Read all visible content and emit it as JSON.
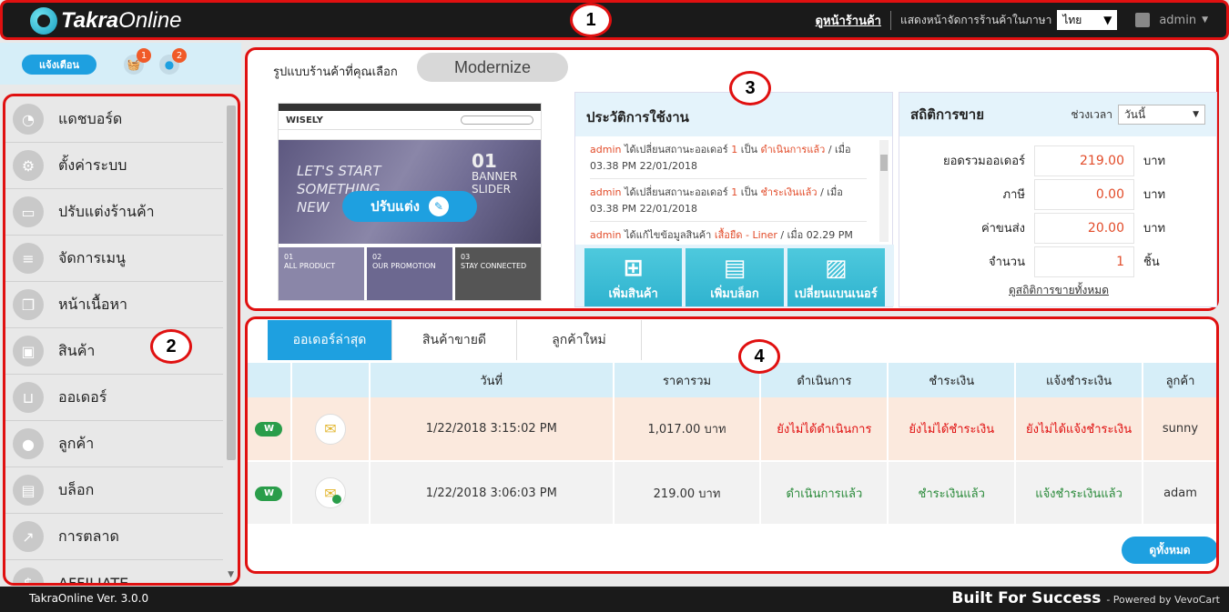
{
  "header": {
    "logo_main": "Takra",
    "logo_sub": "Online",
    "storefront_link": "ดูหน้าร้านค้า",
    "language_label": "แสดงหน้าจัดการร้านค้าในภาษา",
    "language_value": "ไทย",
    "user_name": "admin"
  },
  "sidebar_top": {
    "notify_button": "แจ้งเตือน",
    "cart_badge": "1",
    "user_badge": "2"
  },
  "sidebar": {
    "items": [
      {
        "label": "แดชบอร์ด",
        "icon": "dashboard-icon"
      },
      {
        "label": "ตั้งค่าระบบ",
        "icon": "gear-icon"
      },
      {
        "label": "ปรับแต่งร้านค้า",
        "icon": "monitor-icon"
      },
      {
        "label": "จัดการเมนู",
        "icon": "menu-icon"
      },
      {
        "label": "หน้าเนื้อหา",
        "icon": "pages-icon"
      },
      {
        "label": "สินค้า",
        "icon": "box-icon"
      },
      {
        "label": "ออเดอร์",
        "icon": "basket-icon"
      },
      {
        "label": "ลูกค้า",
        "icon": "person-icon"
      },
      {
        "label": "บล็อก",
        "icon": "blog-icon"
      },
      {
        "label": "การตลาด",
        "icon": "chart-icon"
      },
      {
        "label": "AFFILIATE",
        "icon": "dollar-icon"
      }
    ]
  },
  "annotations": [
    "1",
    "2",
    "3",
    "4"
  ],
  "theme": {
    "label": "รูปแบบร้านค้าที่คุณเลือก",
    "name": "Modernize",
    "customize_button": "ปรับแต่ง",
    "preview_brand": "WISELY",
    "preview_banner_left": "LET'S START SOMETHING NEW",
    "preview_banner_num": "01",
    "preview_banner_right": "BANNER SLIDER",
    "preview_tiles": [
      {
        "num": "01",
        "text": "ALL PRODUCT"
      },
      {
        "num": "02",
        "text": "OUR PROMOTION"
      },
      {
        "num": "03",
        "text": "STAY CONNECTED"
      }
    ]
  },
  "history": {
    "title": "ประวัติการใช้งาน",
    "entries": [
      {
        "user": "admin",
        "a": " ได้เปลี่ยนสถานะออเดอร์ ",
        "num": "1",
        "b": " เป็น ",
        "status": "ดำเนินการแล้ว",
        "c": " / เมื่อ 03.38 PM 22/01/2018"
      },
      {
        "user": "admin",
        "a": " ได้เปลี่ยนสถานะออเดอร์ ",
        "num": "1",
        "b": " เป็น ",
        "status": "ชำระเงินแล้ว",
        "c": " / เมื่อ 03.38 PM 22/01/2018"
      },
      {
        "user": "admin",
        "a": " ได้แก้ไขข้อมูลสินค้า ",
        "num": "",
        "b": "",
        "status": "เสื้อยืด - Liner",
        "c": " / เมื่อ 02.29 PM"
      }
    ],
    "quick_actions": [
      {
        "label": "เพิ่มสินค้า",
        "icon": "add-product-icon"
      },
      {
        "label": "เพิ่มบล็อก",
        "icon": "add-blog-icon"
      },
      {
        "label": "เปลี่ยนแบนเนอร์",
        "icon": "change-banner-icon"
      }
    ]
  },
  "stats": {
    "title": "สถิติการขาย",
    "period_label": "ช่วงเวลา",
    "period_value": "วันนี้",
    "rows": [
      {
        "label": "ยอดรวมออเดอร์",
        "value": "219.00",
        "unit": "บาท"
      },
      {
        "label": "ภาษี",
        "value": "0.00",
        "unit": "บาท"
      },
      {
        "label": "ค่าขนส่ง",
        "value": "20.00",
        "unit": "บาท"
      },
      {
        "label": "จำนวน",
        "value": "1",
        "unit": "ชิ้น"
      }
    ],
    "view_all_link": "ดูสถิติการขายทั้งหมด"
  },
  "orders": {
    "tabs": [
      "ออเดอร์ล่าสุด",
      "สินค้าขายดี",
      "ลูกค้าใหม่"
    ],
    "columns": [
      "",
      "",
      "วันที่",
      "ราคารวม",
      "ดำเนินการ",
      "ชำระเงิน",
      "แจ้งชำระเงิน",
      "ลูกค้า"
    ],
    "rows": [
      {
        "badge": "W",
        "date": "1/22/2018 3:15:02 PM",
        "total": "1,017.00 บาท",
        "process": "ยังไม่ได้ดำเนินการ",
        "payment": "ยังไม่ได้ชำระเงิน",
        "notify": "ยังไม่ได้แจ้งชำระเงิน",
        "customer": "sunny"
      },
      {
        "badge": "W",
        "date": "1/22/2018 3:06:03 PM",
        "total": "219.00 บาท",
        "process": "ดำเนินการแล้ว",
        "payment": "ชำระเงินแล้ว",
        "notify": "แจ้งชำระเงินแล้ว",
        "customer": "adam"
      }
    ],
    "view_all_button": "ดูทั้งหมด"
  },
  "footer": {
    "version": "TakraOnline Ver. 3.0.0",
    "tagline": "Built For Success",
    "powered": "- Powered by VevoCart"
  },
  "colors": {
    "accent": "#1ea0e0",
    "annotation_red": "#e01010",
    "status_red": "#e01010",
    "status_green": "#2a8a3a"
  }
}
